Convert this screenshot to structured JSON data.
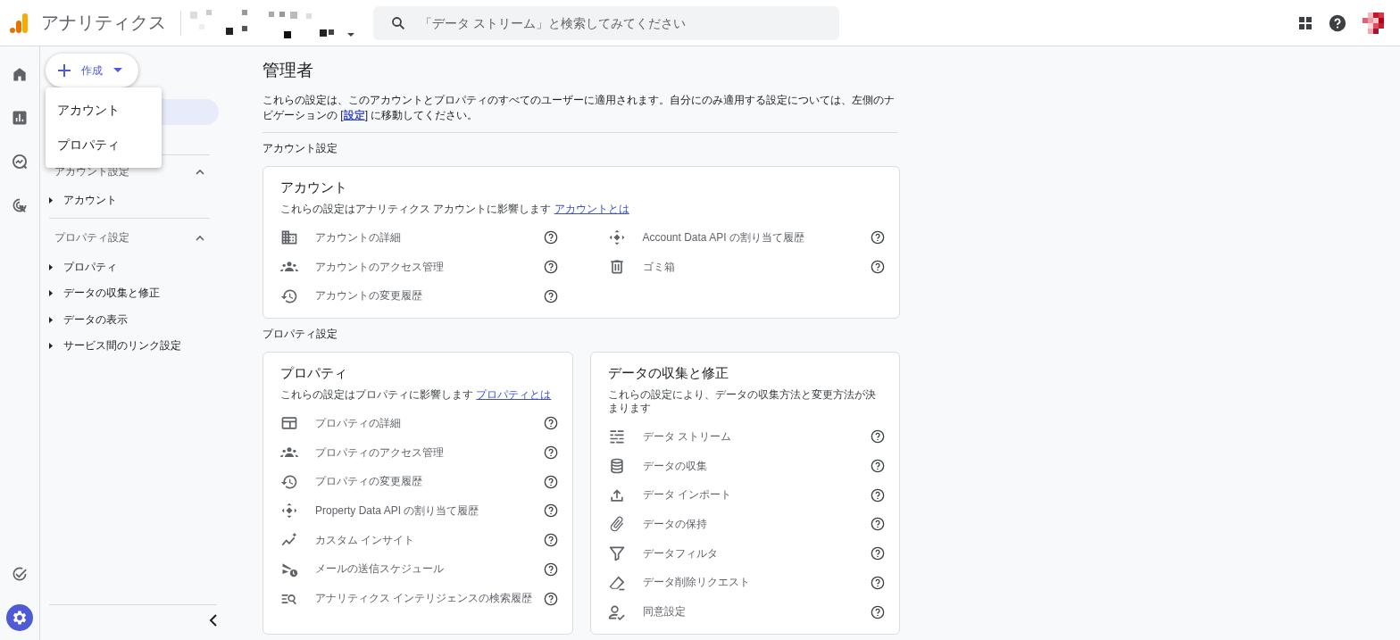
{
  "app": {
    "title": "アナリティクス"
  },
  "search": {
    "placeholder": "「データ ストリーム」と検索してみてください"
  },
  "rail": [
    {
      "selected": false
    },
    {
      "selected": false
    },
    {
      "selected": false
    },
    {
      "selected": false
    },
    {
      "selected": false
    },
    {
      "selected": true
    }
  ],
  "create_button": {
    "label": "作成"
  },
  "create_menu": {
    "items": [
      "アカウント",
      "プロパティ"
    ]
  },
  "nav": {
    "sections": [
      {
        "title": "アカウント設定",
        "expanded": true,
        "items": [
          "アカウント"
        ]
      },
      {
        "title": "プロパティ設定",
        "expanded": true,
        "items": [
          "プロパティ",
          "データの収集と修正",
          "データの表示",
          "サービス間のリンク設定"
        ]
      }
    ]
  },
  "page": {
    "title": "管理者",
    "intro": {
      "before": "これらの設定は、このアカウントとプロパティのすべてのユーザーに適用されます。自分にのみ適用する設定については、左側のナビゲーションの [",
      "link": "設定",
      "after": "] に移動してください。"
    },
    "sections": [
      {
        "heading": "アカウント設定",
        "cards": [
          {
            "title": "アカウント",
            "description": "これらの設定はアナリティクス アカウントに影響します",
            "link": "アカウントとは",
            "columns": [
              [
                "アカウントの詳細",
                "アカウントのアクセス管理",
                "アカウントの変更履歴"
              ],
              [
                "Account Data API の割り当て履歴",
                "ゴミ箱"
              ]
            ]
          }
        ]
      },
      {
        "heading": "プロパティ設定",
        "cards": [
          {
            "title": "プロパティ",
            "description": "これらの設定はプロパティに影響します",
            "link": "プロパティとは",
            "columns": [
              [
                "プロパティの詳細",
                "プロパティのアクセス管理",
                "プロパティの変更履歴",
                "Property Data API の割り当て履歴",
                "カスタム インサイト",
                "メールの送信スケジュール",
                "アナリティクス インテリジェンスの検索履歴"
              ]
            ]
          },
          {
            "title": "データの収集と修正",
            "description": "これらの設定により、データの収集方法と変更方法が決まります",
            "columns": [
              [
                "データ ストリーム",
                "データの収集",
                "データ インポート",
                "データの保持",
                "データフィルタ",
                "データ削除リクエスト",
                "同意設定"
              ]
            ]
          }
        ]
      }
    ]
  }
}
